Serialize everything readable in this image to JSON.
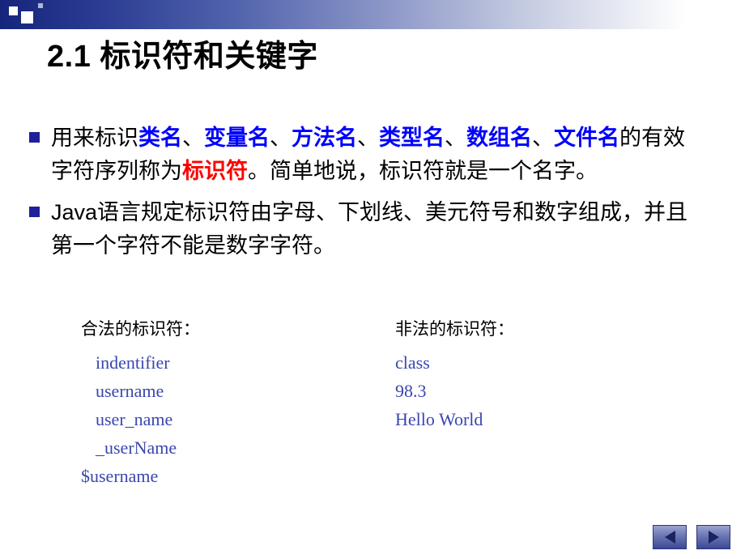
{
  "slide": {
    "title": "2.1 标识符和关键字",
    "bullets": [
      {
        "id": "bullet-1",
        "segments": [
          {
            "text": "用来标识",
            "style": "normal"
          },
          {
            "text": "类名",
            "style": "blue"
          },
          {
            "text": "、",
            "style": "normal"
          },
          {
            "text": "变量名",
            "style": "blue"
          },
          {
            "text": "、",
            "style": "normal"
          },
          {
            "text": "方法名",
            "style": "blue"
          },
          {
            "text": "、",
            "style": "normal"
          },
          {
            "text": "类型名",
            "style": "blue"
          },
          {
            "text": "、",
            "style": "normal"
          },
          {
            "text": "数组名",
            "style": "blue"
          },
          {
            "text": "、",
            "style": "normal"
          },
          {
            "text": "文件名",
            "style": "blue"
          },
          {
            "text": "的有效字符序列称为",
            "style": "normal"
          },
          {
            "text": "标识符",
            "style": "red"
          },
          {
            "text": "。简单地说，标识符就是一个名字。",
            "style": "normal"
          }
        ]
      },
      {
        "id": "bullet-2",
        "segments": [
          {
            "text": "Java语言规定标识符由字母、下划线、美元符号和数字组成，并且第一个字符不能是数字字符。",
            "style": "normal"
          }
        ]
      }
    ],
    "examples": {
      "legal": {
        "heading": "合法的标识符：",
        "items": [
          "indentifier",
          "username",
          "user_name",
          "_userName",
          "$username"
        ]
      },
      "illegal": {
        "heading": "非法的标识符：",
        "items": [
          "class",
          "98.3",
          "Hello World"
        ]
      }
    },
    "nav": {
      "prev_label": "◀",
      "next_label": "▶"
    },
    "colors": {
      "bullet_marker": "#1f1f9c",
      "keyword_blue": "#0000ff",
      "highlight_red": "#ff0000",
      "example_text": "#3a47b0"
    }
  }
}
